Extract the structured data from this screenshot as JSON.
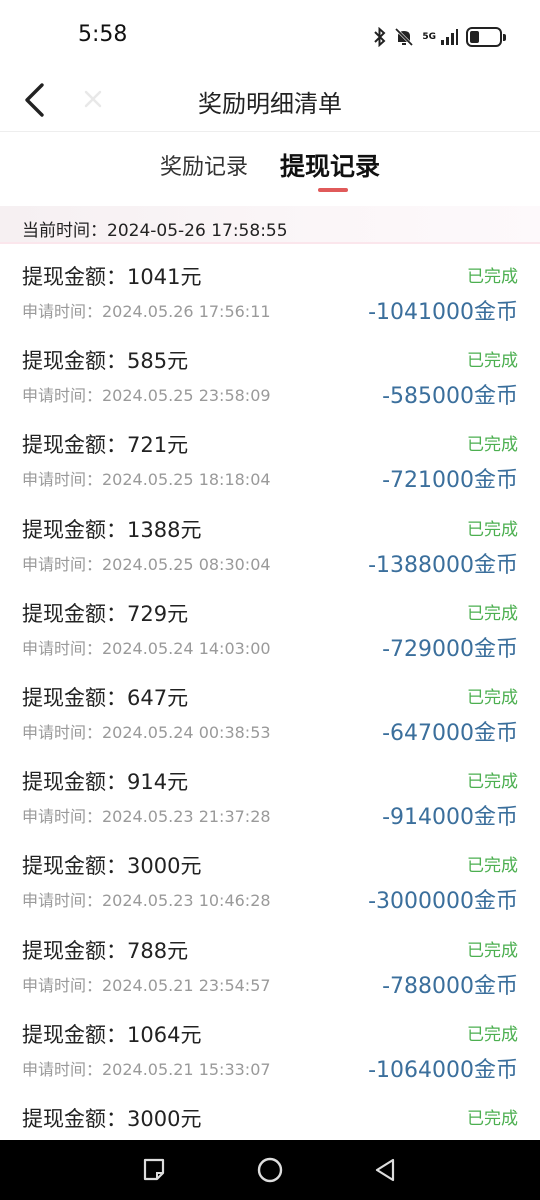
{
  "status_bar": {
    "time": "5:58",
    "network": "5G",
    "icons": [
      "bluetooth-icon",
      "bell-muted-icon",
      "signal-5g-icon",
      "battery-icon"
    ]
  },
  "header": {
    "title": "奖励明细清单",
    "back_icon": "chevron-left-icon",
    "close_icon": "close-icon"
  },
  "tabs": [
    {
      "label": "奖励记录",
      "active": false
    },
    {
      "label": "提现记录",
      "active": true
    }
  ],
  "banner": {
    "label": "当前时间：",
    "value": "2024-05-26 17:58:55"
  },
  "colors": {
    "accent": "#e05a5a",
    "status_green": "#4caf50",
    "coins_blue": "#3b6f9c",
    "muted_text": "#9a9a9a"
  },
  "records": [
    {
      "amount": "提现金额：1041元",
      "time": "申请时间：2024.05.26 17:56:11",
      "status": "已完成",
      "coins": "-1041000金币"
    },
    {
      "amount": "提现金额：585元",
      "time": "申请时间：2024.05.25 23:58:09",
      "status": "已完成",
      "coins": "-585000金币"
    },
    {
      "amount": "提现金额：721元",
      "time": "申请时间：2024.05.25 18:18:04",
      "status": "已完成",
      "coins": "-721000金币"
    },
    {
      "amount": "提现金额：1388元",
      "time": "申请时间：2024.05.25 08:30:04",
      "status": "已完成",
      "coins": "-1388000金币"
    },
    {
      "amount": "提现金额：729元",
      "time": "申请时间：2024.05.24 14:03:00",
      "status": "已完成",
      "coins": "-729000金币"
    },
    {
      "amount": "提现金额：647元",
      "time": "申请时间：2024.05.24 00:38:53",
      "status": "已完成",
      "coins": "-647000金币"
    },
    {
      "amount": "提现金额：914元",
      "time": "申请时间：2024.05.23 21:37:28",
      "status": "已完成",
      "coins": "-914000金币"
    },
    {
      "amount": "提现金额：3000元",
      "time": "申请时间：2024.05.23 10:46:28",
      "status": "已完成",
      "coins": "-3000000金币"
    },
    {
      "amount": "提现金额：788元",
      "time": "申请时间：2024.05.21 23:54:57",
      "status": "已完成",
      "coins": "-788000金币"
    },
    {
      "amount": "提现金额：1064元",
      "time": "申请时间：2024.05.21 15:33:07",
      "status": "已完成",
      "coins": "-1064000金币"
    },
    {
      "amount": "提现金额：3000元",
      "time": "",
      "status": "已完成",
      "coins": ""
    }
  ],
  "nav_bar": {
    "buttons": [
      "recent-apps-icon",
      "home-icon",
      "back-triangle-icon"
    ]
  }
}
